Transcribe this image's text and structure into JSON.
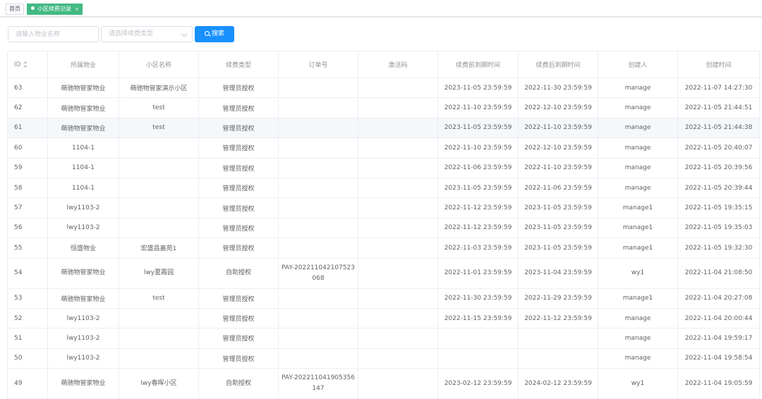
{
  "tabs": {
    "home": "首页",
    "active": "小区续费记录",
    "close": "×"
  },
  "search": {
    "name_placeholder": "请输入物业名称",
    "type_placeholder": "请选择续费类型",
    "button_label": "搜索"
  },
  "table": {
    "headers": [
      "ID",
      "所属物业",
      "小区名称",
      "续费类型",
      "订单号",
      "激活码",
      "续费前到期时间",
      "续费后到期时间",
      "创建人",
      "创建时间"
    ],
    "rows": [
      [
        "63",
        "萌驰物管家物业",
        "萌驰物管家演示小区",
        "管理员授权",
        "",
        "",
        "2023-11-05 23:59:59",
        "2022-11-30 23:59:59",
        "manage",
        "2022-11-07 14:27:30"
      ],
      [
        "62",
        "萌驰物管家物业",
        "test",
        "管理员授权",
        "",
        "",
        "2022-11-10 23:59:59",
        "2022-12-10 23:59:59",
        "manage",
        "2022-11-05 21:44:51"
      ],
      [
        "61",
        "萌驰物管家物业",
        "test",
        "管理员授权",
        "",
        "",
        "2023-11-05 23:59:59",
        "2022-11-10 23:59:59",
        "manage",
        "2022-11-05 21:44:38"
      ],
      [
        "60",
        "1104-1",
        "",
        "管理员授权",
        "",
        "",
        "2022-11-10 23:59:59",
        "2022-12-10 23:59:59",
        "manage",
        "2022-11-05 20:40:07"
      ],
      [
        "59",
        "1104-1",
        "",
        "管理员授权",
        "",
        "",
        "2022-11-06 23:59:59",
        "2022-11-10 23:59:59",
        "manage",
        "2022-11-05 20:39:56"
      ],
      [
        "58",
        "1104-1",
        "",
        "管理员授权",
        "",
        "",
        "2023-11-05 23:59:59",
        "2022-11-06 23:59:59",
        "manage",
        "2022-11-05 20:39:44"
      ],
      [
        "57",
        "lwy1103-2",
        "",
        "管理员授权",
        "",
        "",
        "2022-11-12 23:59:59",
        "2023-11-05 23:59:59",
        "manage1",
        "2022-11-05 19:35:15"
      ],
      [
        "56",
        "lwy1103-2",
        "",
        "管理员授权",
        "",
        "",
        "2022-11-12 23:59:59",
        "2023-11-05 23:59:59",
        "manage1",
        "2022-11-05 19:35:03"
      ],
      [
        "55",
        "恒盛物业",
        "宏盛昌嘉苑1",
        "管理员授权",
        "",
        "",
        "2022-11-03 23:59:59",
        "2023-11-05 23:59:59",
        "manage1",
        "2022-11-05 19:32:30"
      ],
      [
        "54",
        "萌驰物管家物业",
        "lwy夏霞园",
        "自助授权",
        "PAY-202211042107523068",
        "",
        "2022-11-01 23:59:59",
        "2023-11-04 23:59:59",
        "wy1",
        "2022-11-04 21:08:50"
      ],
      [
        "53",
        "萌驰物管家物业",
        "test",
        "管理员授权",
        "",
        "",
        "2022-11-30 23:59:59",
        "2022-11-29 23:59:59",
        "manage1",
        "2022-11-04 20:27:08"
      ],
      [
        "52",
        "lwy1103-2",
        "",
        "管理员授权",
        "",
        "",
        "2022-11-15 23:59:59",
        "2022-11-12 23:59:59",
        "manage",
        "2022-11-04 20:00:44"
      ],
      [
        "51",
        "lwy1103-2",
        "",
        "管理员授权",
        "",
        "",
        "",
        "",
        "manage",
        "2022-11-04 19:59:17"
      ],
      [
        "50",
        "lwy1103-2",
        "",
        "管理员授权",
        "",
        "",
        "",
        "",
        "manage",
        "2022-11-04 19:58:54"
      ],
      [
        "49",
        "萌驰物管家物业",
        "lwy春晖小区",
        "自助授权",
        "PAY-202211041905356147",
        "",
        "2023-02-12 23:59:59",
        "2024-02-12 23:59:59",
        "wy1",
        "2022-11-04 19:05:59"
      ]
    ]
  }
}
